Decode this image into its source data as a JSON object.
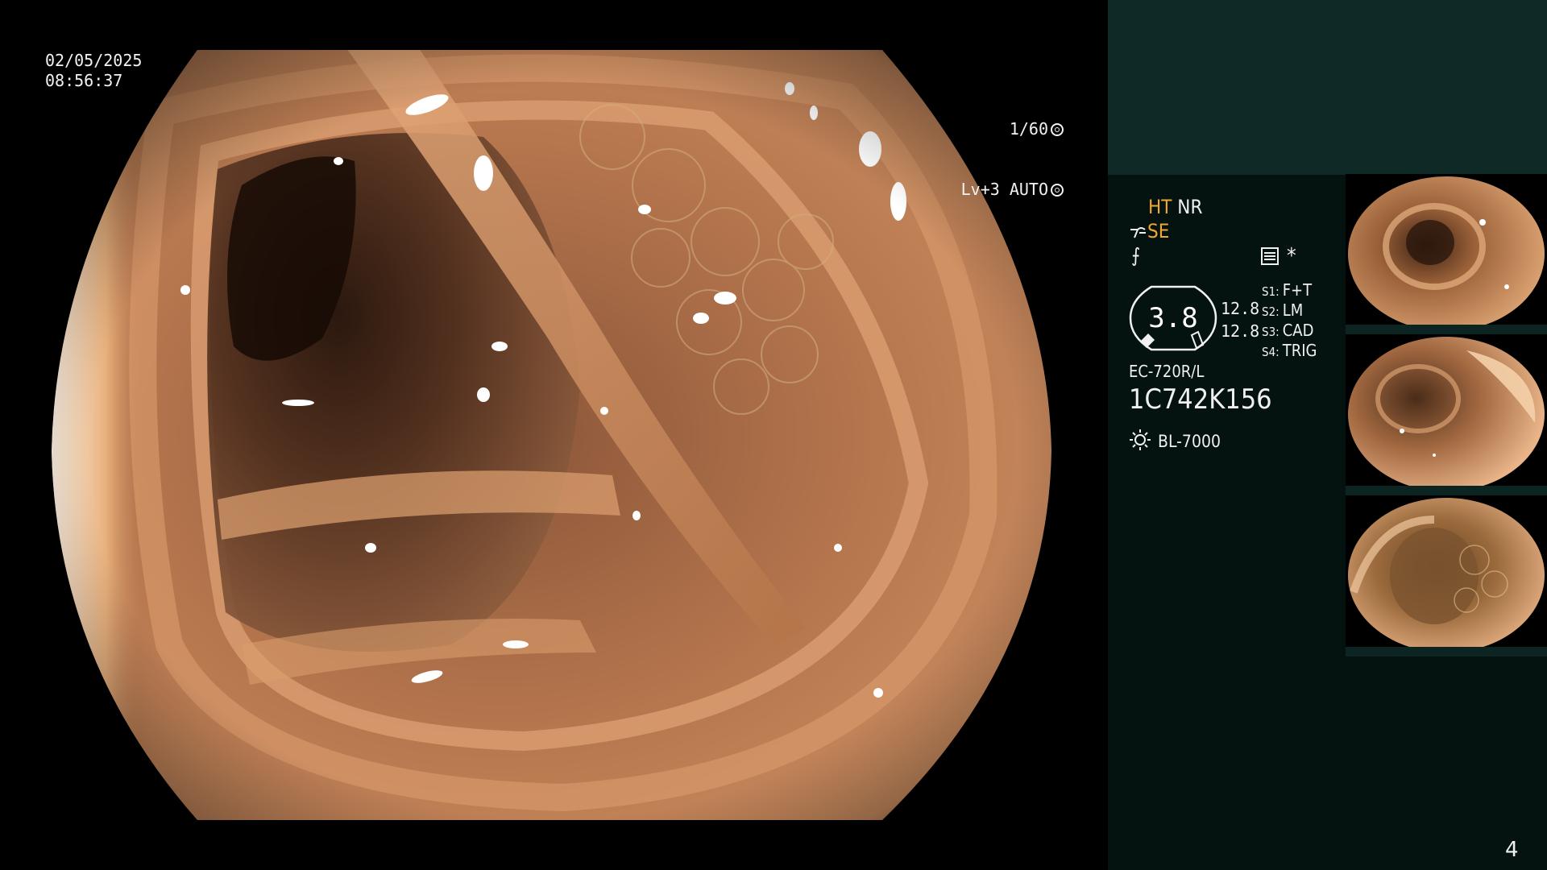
{
  "overlay": {
    "date": "02/05/2025",
    "time": "08:56:37",
    "shutter": "1/60",
    "iris": "Lv+3 AUTO"
  },
  "panel": {
    "ht_label": "HT",
    "nr_label": "NR",
    "se_label": "SE",
    "filter_symbol": "⨍",
    "asterisk": "*",
    "zoom_value": "3.8",
    "zoom_a": "12.8",
    "zoom_b": "12.8",
    "switches": [
      {
        "key": "S1:",
        "value": "F+T"
      },
      {
        "key": "S2:",
        "value": "LM"
      },
      {
        "key": "S3:",
        "value": "CAD"
      },
      {
        "key": "S4:",
        "value": "TRIG"
      }
    ],
    "scope_model": "EC-720R/L",
    "scope_serial": "1C742K156",
    "light_source": "BL-7000"
  },
  "page_number": "4",
  "colors": {
    "panel_bg": "#041210",
    "panel_band": "#0f2927",
    "accent_orange": "#f0a830",
    "mucosa": "#b4724a"
  },
  "icons": [
    "shutter-icon",
    "iris-icon",
    "structure-enhance-icon",
    "filter-icon",
    "image-settings-icon",
    "light-source-icon"
  ]
}
